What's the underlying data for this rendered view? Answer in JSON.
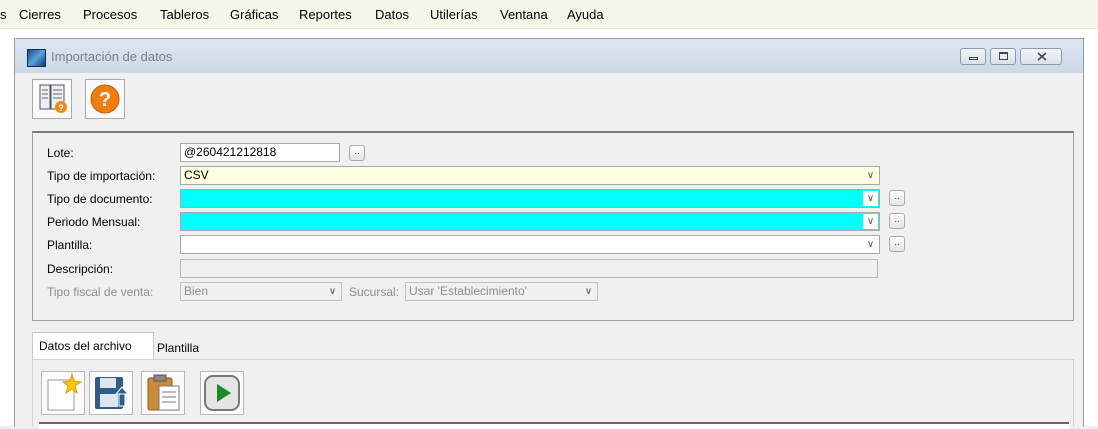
{
  "menu": [
    "s",
    "Cierres",
    "Procesos",
    "Tableros",
    "Gráficas",
    "Reportes",
    "Datos",
    "Utilerías",
    "Ventana",
    "Ayuda"
  ],
  "window": {
    "title": "Importación de datos"
  },
  "toolbar": {
    "icons": [
      "report-icon",
      "help-icon"
    ]
  },
  "form": {
    "lote": {
      "label": "Lote:",
      "value": "@260421212818"
    },
    "tipo_importacion": {
      "label": "Tipo de importación:",
      "value": "CSV"
    },
    "tipo_documento": {
      "label": "Tipo de documento:",
      "value": ""
    },
    "periodo": {
      "label": "Periodo Mensual:",
      "value": ""
    },
    "plantilla": {
      "label": "Plantilla:",
      "value": ""
    },
    "descripcion": {
      "label": "Descripción:",
      "value": ""
    },
    "tipo_fiscal": {
      "label": "Tipo fiscal de venta:",
      "value": "Bien"
    },
    "sucursal": {
      "label": "Sucursal:",
      "value": "Usar 'Establecimiento'"
    }
  },
  "tabs": [
    "Datos del archivo",
    "Plantilla"
  ],
  "actions": {
    "icons": [
      "new-icon",
      "save-icon",
      "paste-icon",
      "play-icon"
    ]
  },
  "colors": {
    "required": "#00ffff",
    "highlight": "#ffffe1",
    "play": "#1c8a2a"
  },
  "dots_label": ".."
}
